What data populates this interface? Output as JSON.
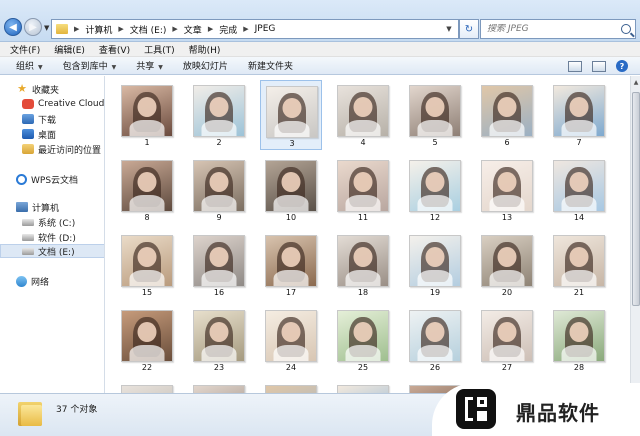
{
  "address": {
    "crumbs": [
      "计算机",
      "文档 (E:)",
      "文章",
      "完成",
      "JPEG"
    ],
    "search_placeholder": "搜索 JPEG"
  },
  "menu": [
    "文件(F)",
    "编辑(E)",
    "查看(V)",
    "工具(T)",
    "帮助(H)"
  ],
  "toolbar": {
    "organize": "组织",
    "include_library": "包含到库中",
    "share": "共享",
    "slideshow": "放映幻灯片",
    "new_folder": "新建文件夹"
  },
  "sidebar": {
    "favorites": "收藏夹",
    "creative_cloud": "Creative Cloud Files",
    "downloads": "下载",
    "desktop": "桌面",
    "recent": "最近访问的位置",
    "wps_cloud": "WPS云文档",
    "computer": "计算机",
    "drive_c": "系统 (C:)",
    "drive_d": "软件 (D:)",
    "drive_e": "文档 (E:)",
    "network": "网络"
  },
  "files": [
    "1",
    "2",
    "3",
    "4",
    "5",
    "6",
    "7",
    "8",
    "9",
    "10",
    "11",
    "12",
    "13",
    "14",
    "15",
    "16",
    "17",
    "18",
    "19",
    "20",
    "21",
    "22",
    "23",
    "24",
    "25",
    "26",
    "27",
    "28"
  ],
  "partial_row_count": 7,
  "status": {
    "item_count": "37 个对象"
  },
  "watermark": {
    "text": "鼎品软件"
  },
  "colors": {
    "titlebar": "#c6dbf1",
    "selection": "#e3eefa",
    "text": "#1e1e1e"
  }
}
